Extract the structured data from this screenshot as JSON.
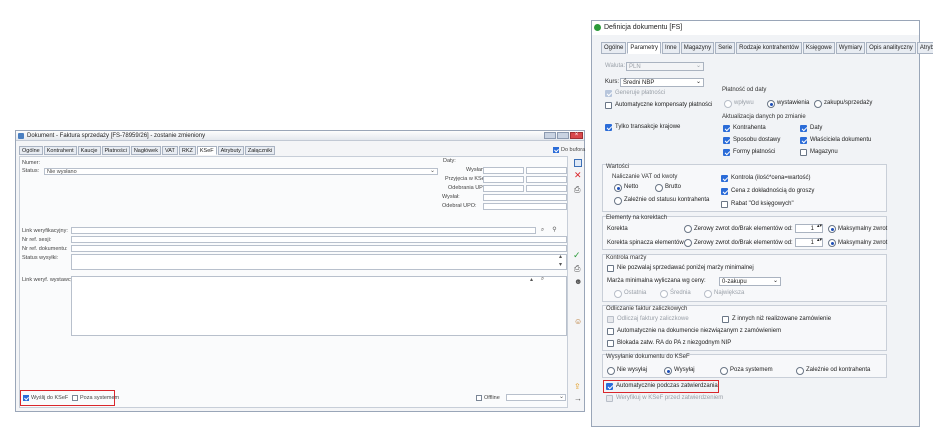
{
  "left": {
    "title": "Dokument - Faktura sprzedaży [FS-78959/26] - zostanie zmieniony",
    "tabs": [
      "Ogólne",
      "Kontrahent",
      "Kaucje",
      "Płatności",
      "Nagłówek",
      "VAT",
      "RKZ",
      "KSeF",
      "Atrybuty",
      "Załączniki"
    ],
    "do_bufora": "Do bufora",
    "numer_label": "Numer:",
    "status_label": "Status:",
    "status_value": "Nie wysłano",
    "daty_label": "Daty:",
    "date_labels": [
      "Wysłania",
      "Przyjęcia w KSeF",
      "Odebrania UPO:",
      "Wysłał:",
      "Odebrał UPO:"
    ],
    "link_labels": [
      "Link weryfikacyjny:",
      "Nr ref. sesji:",
      "Nr ref. dokumentu:",
      "Status wysyłki:"
    ],
    "link_wystawcy": "Link weryf. wystawcy:",
    "wyslij": "Wyślij do KSeF",
    "poza": "Poza systemem",
    "offline": "Offline"
  },
  "right": {
    "title": "Definicja dokumentu [FS]",
    "tabs": [
      "Ogólne",
      "Parametry",
      "Inne",
      "Magazyny",
      "Serie",
      "Rodzaje kontrahentów",
      "Księgowe",
      "Wymiary",
      "Opis analityczny",
      "Atrybuty"
    ],
    "waluta_label": "Waluta:",
    "waluta_value": "PLN",
    "kurs_label": "Kurs:",
    "kurs_value": "Średni NBP",
    "generuje": "Generuje płatności",
    "auto_komp": "Automatyczne kompensaty płatności",
    "tylko": "Tylko transakcje krajowe",
    "platnosc_od": "Płatność od daty",
    "platnosc_opts": [
      "wpływu",
      "wystawienia",
      "zakupu/sprzedaży"
    ],
    "aktualizacja": "Aktualizacja danych po zmianie",
    "akt_opts": [
      "Kontrahenta",
      "Daty",
      "Sposobu dostawy",
      "Właściciela dokumentu",
      "Formy płatności",
      "Magazynu"
    ],
    "wartosci": "Wartości",
    "naliczanie": "Naliczanie VAT od kwoty",
    "netto": "Netto",
    "brutto": "Brutto",
    "zalezne_status": "Zależnie od statusu kontrahenta",
    "kontrola": "Kontrola (ilość*cena=wartość)",
    "cena_dokl": "Cena z dokładnością do groszy",
    "rabat": "Rabat \"Od księgowych\"",
    "elementy": "Elementy na korektach",
    "korekta": "Korekta",
    "korekta_spin": "Korekta spinacza elementów",
    "zerowy": "Zerowy zwrot do/Brak elementów od:",
    "spin_value": "1",
    "maksymalny": "Maksymalny zwrot",
    "kontrola_marzy": "Kontrola marży",
    "nie_pozwalaj": "Nie pozwalaj sprzedawać poniżej marży minimalnej",
    "marza_min": "Marża minimalna wyliczana wg ceny:",
    "marza_value": "0-zakupu",
    "marza_opts": [
      "Ostatnia",
      "Średnia",
      "Największa"
    ],
    "odliczanie": "Odliczanie faktur zaliczkowych",
    "odliczaj": "Odliczaj faktury zaliczkowe",
    "z_innych": "Z innych niż realizowane zamówienie",
    "auto_dok": "Automatycznie na dokumencie niezwiązanym z zamówieniem",
    "blokada": "Blokada zatw. RA do PA z niezgodnym NIP",
    "wysylanie": "Wysyłanie dokumentu do KSeF",
    "wys_opts": [
      "Nie wysyłaj",
      "Wysyłaj",
      "Poza systemem",
      "Zależnie od kontrahenta"
    ],
    "auto_zatw": "Automatycznie podczas zatwierdzania",
    "weryfikuj": "Weryfikuj w KSeF przed zatwierdzeniem"
  }
}
